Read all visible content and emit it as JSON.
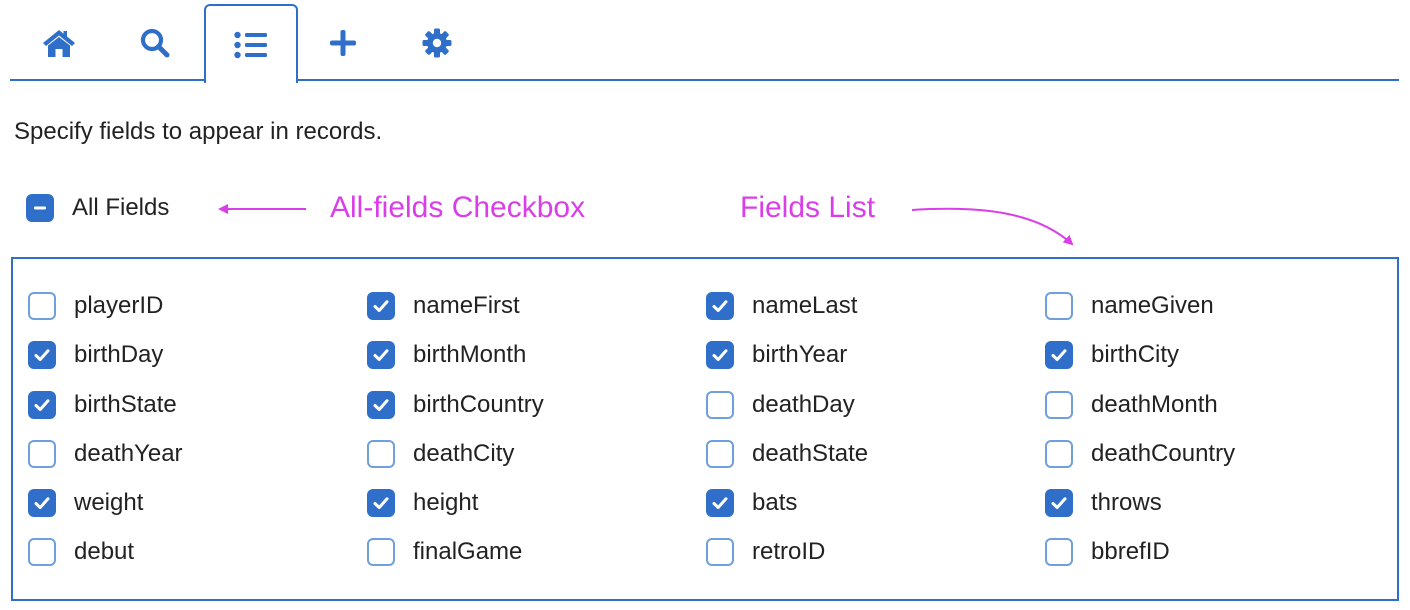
{
  "tabs": [
    {
      "icon": "home-icon",
      "active": false
    },
    {
      "icon": "search-icon",
      "active": false
    },
    {
      "icon": "list-icon",
      "active": true
    },
    {
      "icon": "plus-icon",
      "active": false
    },
    {
      "icon": "gear-icon",
      "active": false
    }
  ],
  "intro_text": "Specify fields to appear in records.",
  "all_fields": {
    "label": "All Fields",
    "state": "indeterminate"
  },
  "annotations": {
    "all_fields_checkbox": "All-fields Checkbox",
    "fields_list": "Fields List"
  },
  "colors": {
    "accent": "#2f6fc9",
    "annotation": "#d93ee8",
    "unchecked_border": "#6f9fdc"
  },
  "fields": [
    [
      {
        "name": "playerID",
        "checked": false
      },
      {
        "name": "birthDay",
        "checked": true
      },
      {
        "name": "birthState",
        "checked": true
      },
      {
        "name": "deathYear",
        "checked": false
      },
      {
        "name": "weight",
        "checked": true
      },
      {
        "name": "debut",
        "checked": false
      }
    ],
    [
      {
        "name": "nameFirst",
        "checked": true
      },
      {
        "name": "birthMonth",
        "checked": true
      },
      {
        "name": "birthCountry",
        "checked": true
      },
      {
        "name": "deathCity",
        "checked": false
      },
      {
        "name": "height",
        "checked": true
      },
      {
        "name": "finalGame",
        "checked": false
      }
    ],
    [
      {
        "name": "nameLast",
        "checked": true
      },
      {
        "name": "birthYear",
        "checked": true
      },
      {
        "name": "deathDay",
        "checked": false
      },
      {
        "name": "deathState",
        "checked": false
      },
      {
        "name": "bats",
        "checked": true
      },
      {
        "name": "retroID",
        "checked": false
      }
    ],
    [
      {
        "name": "nameGiven",
        "checked": false
      },
      {
        "name": "birthCity",
        "checked": true
      },
      {
        "name": "deathMonth",
        "checked": false
      },
      {
        "name": "deathCountry",
        "checked": false
      },
      {
        "name": "throws",
        "checked": true
      },
      {
        "name": "bbrefID",
        "checked": false
      }
    ]
  ]
}
